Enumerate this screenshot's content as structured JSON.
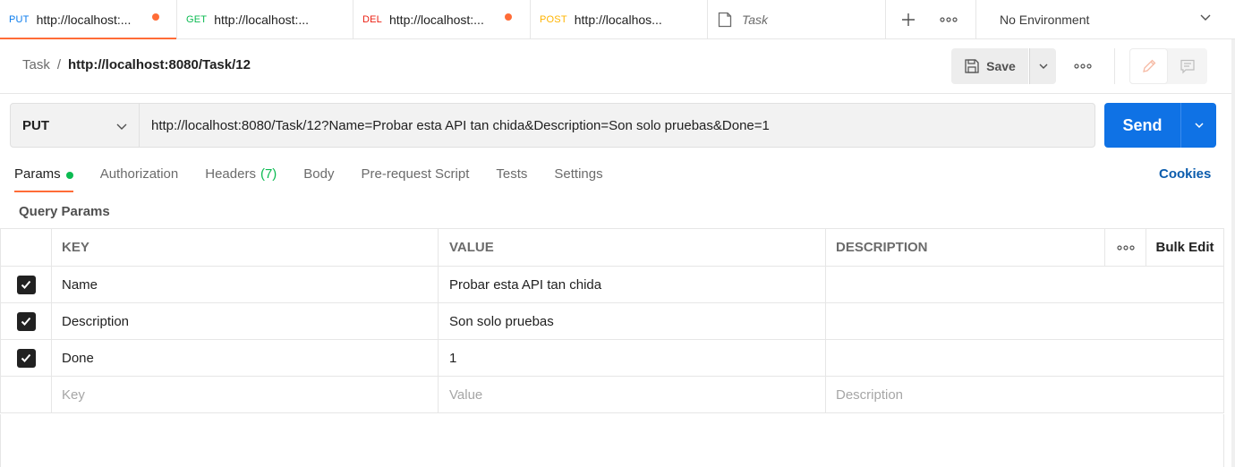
{
  "tabs": [
    {
      "method": "PUT",
      "method_color": "#097bed",
      "url": "http://localhost:...",
      "unsaved": true,
      "active": true
    },
    {
      "method": "GET",
      "method_color": "#0cbb52",
      "url": "http://localhost:...",
      "unsaved": false,
      "active": false
    },
    {
      "method": "DEL",
      "method_color": "#eb2013",
      "url": "http://localhost:...",
      "unsaved": true,
      "active": false
    },
    {
      "method": "POST",
      "method_color": "#ffb400",
      "url": "http://localhos...",
      "unsaved": false,
      "active": false
    },
    {
      "icon": "document-icon",
      "label": "Task"
    }
  ],
  "tab_actions": {
    "new_tab_icon": "plus-icon",
    "more_icon": "ellipsis-icon"
  },
  "environment": {
    "label": "No Environment",
    "icon": "chevron-down-icon"
  },
  "breadcrumb": {
    "parent": "Task",
    "separator": "/",
    "current": "http://localhost:8080/Task/12"
  },
  "toolbar": {
    "save_label": "Save",
    "save_icon": "save-icon",
    "more_icon": "ellipsis-icon",
    "edit_icon": "pencil-icon",
    "comment_icon": "comment-icon"
  },
  "request": {
    "method": "PUT",
    "url": "http://localhost:8080/Task/12?Name=Probar esta API tan chida&Description=Son solo pruebas&Done=1",
    "send_label": "Send"
  },
  "request_tabs": [
    {
      "label": "Params",
      "active": true,
      "indicator": true
    },
    {
      "label": "Authorization"
    },
    {
      "label": "Headers",
      "count": "(7)"
    },
    {
      "label": "Body"
    },
    {
      "label": "Pre-request Script"
    },
    {
      "label": "Tests"
    },
    {
      "label": "Settings"
    }
  ],
  "cookies_label": "Cookies",
  "query_params": {
    "title": "Query Params",
    "headers": {
      "key": "KEY",
      "value": "VALUE",
      "description": "DESCRIPTION",
      "bulk_edit": "Bulk Edit"
    },
    "rows": [
      {
        "checked": true,
        "key": "Name",
        "value": "Probar esta API tan chida",
        "description": ""
      },
      {
        "checked": true,
        "key": "Description",
        "value": "Son solo pruebas",
        "description": ""
      },
      {
        "checked": true,
        "key": "Done",
        "value": "1",
        "description": ""
      }
    ],
    "placeholders": {
      "key": "Key",
      "value": "Value",
      "description": "Description"
    }
  },
  "colors": {
    "accent": "#ff6c37",
    "primary": "#0f72e5",
    "success": "#0cbb52",
    "link": "#0b5cad"
  }
}
